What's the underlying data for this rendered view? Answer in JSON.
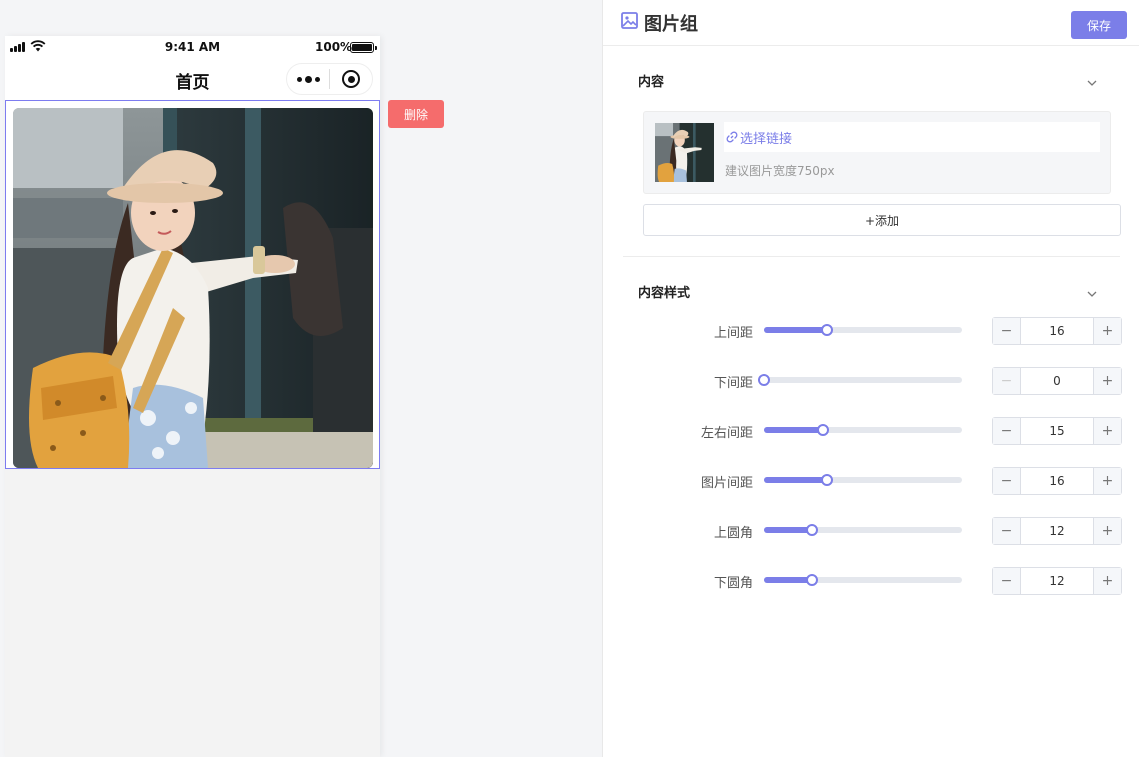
{
  "status_bar": {
    "time": "9:41 AM",
    "battery": "100%"
  },
  "mini_nav": {
    "title": "首页"
  },
  "preview": {
    "delete_label": "删除"
  },
  "panel": {
    "title": "图片组",
    "save_label": "保存"
  },
  "content_section": {
    "title": "内容",
    "link_label": "选择链接",
    "hint": "建议图片宽度750px",
    "add_label": "+添加"
  },
  "style_section": {
    "title": "内容样式",
    "rows": [
      {
        "label": "上间距",
        "value": 16,
        "fraction": 0.32,
        "minus_disabled": false
      },
      {
        "label": "下间距",
        "value": 0,
        "fraction": 0.0,
        "minus_disabled": true
      },
      {
        "label": "左右间距",
        "value": 15,
        "fraction": 0.3,
        "minus_disabled": false
      },
      {
        "label": "图片间距",
        "value": 16,
        "fraction": 0.32,
        "minus_disabled": false
      },
      {
        "label": "上圆角",
        "value": 12,
        "fraction": 0.24,
        "minus_disabled": false
      },
      {
        "label": "下圆角",
        "value": 12,
        "fraction": 0.24,
        "minus_disabled": false
      }
    ]
  },
  "colors": {
    "accent": "#7b7ee8",
    "danger": "#f56c6c"
  }
}
